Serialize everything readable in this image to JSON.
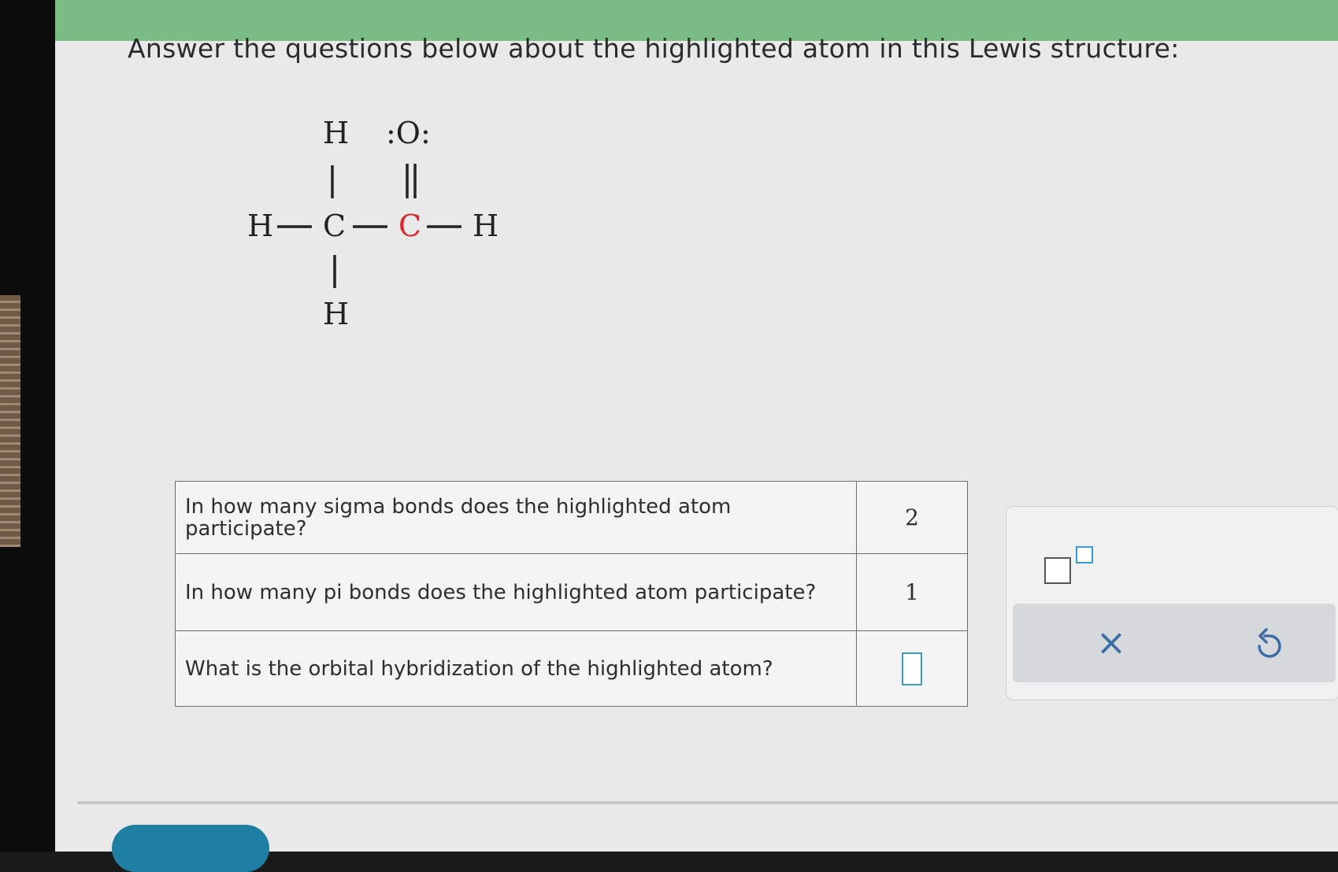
{
  "colors": {
    "topbar": "#7bbd85",
    "highlight": "#d9242b",
    "accent": "#3a9ad6",
    "continue_button": "#1f7fa3"
  },
  "prompt": "Answer the questions below about the highlighted atom in this Lewis structure:",
  "lewis_structure": {
    "atoms": {
      "h_top": "H",
      "o_top": ":O:",
      "h_left": "H",
      "c_left": "C",
      "c_center_highlighted": "C",
      "h_right": "H",
      "h_bottom": "H"
    }
  },
  "questions": [
    {
      "question": "In how many sigma bonds does the highlighted atom participate?",
      "answer": "2"
    },
    {
      "question": "In how many pi bonds does the highlighted atom participate?",
      "answer": "1"
    },
    {
      "question": "What is the orbital hybridization of the highlighted atom?",
      "answer": ""
    }
  ],
  "tools": {
    "superscript_icon": "superscript-box-icon",
    "clear_icon": "x-icon",
    "clear_glyph": "×",
    "undo_icon": "undo-icon"
  }
}
